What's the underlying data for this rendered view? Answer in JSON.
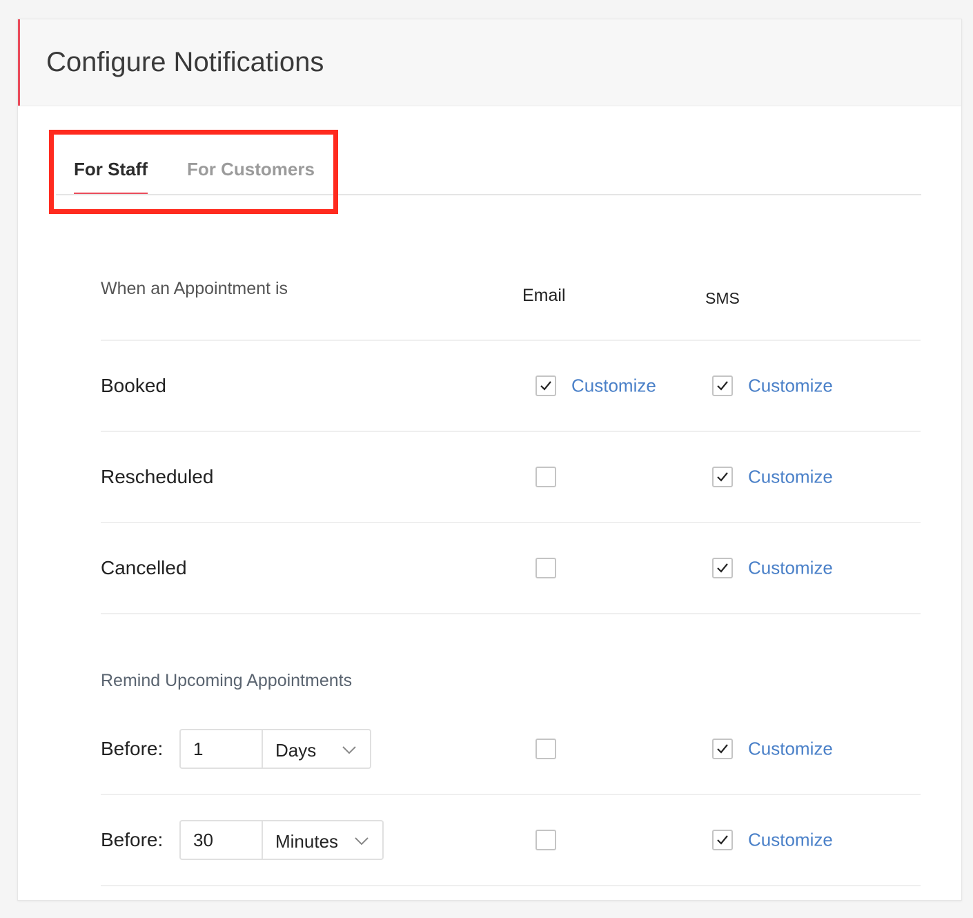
{
  "header": {
    "title": "Configure Notifications"
  },
  "tabs": [
    {
      "label": "For Staff",
      "active": true
    },
    {
      "label": "For Customers",
      "active": false
    }
  ],
  "columns": {
    "event": "When an Appointment is",
    "email": "Email",
    "sms": "SMS"
  },
  "events": [
    {
      "label": "Booked",
      "email_checked": true,
      "sms_checked": true,
      "customize_label": "Customize"
    },
    {
      "label": "Rescheduled",
      "email_checked": false,
      "sms_checked": true,
      "customize_label": "Customize"
    },
    {
      "label": "Cancelled",
      "email_checked": false,
      "sms_checked": true,
      "customize_label": "Customize"
    }
  ],
  "reminders": {
    "title": "Remind Upcoming Appointments",
    "items": [
      {
        "label": "Before:",
        "value": "1",
        "unit": "Days",
        "email_checked": false,
        "sms_checked": true,
        "customize_label": "Customize"
      },
      {
        "label": "Before:",
        "value": "30",
        "unit": "Minutes",
        "email_checked": false,
        "sms_checked": true,
        "customize_label": "Customize"
      }
    ]
  },
  "colors": {
    "accent": "#ea4c5b",
    "link": "#4a80c8",
    "highlight": "#ff2b1f"
  },
  "icons": {
    "check": "checkmark-icon",
    "dropdown": "chevron-down-icon"
  }
}
